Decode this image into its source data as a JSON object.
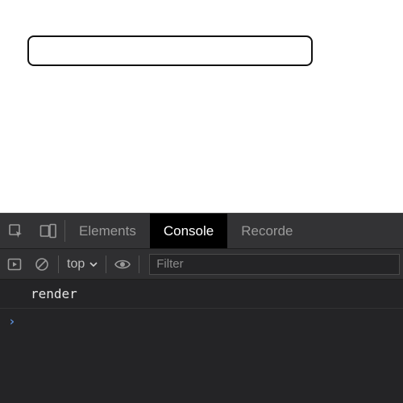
{
  "page": {
    "input_value": ""
  },
  "devtools": {
    "tabs": {
      "elements": "Elements",
      "console": "Console",
      "recorder": "Recorde"
    },
    "active_tab": "console",
    "toolbar": {
      "context_label": "top",
      "filter_placeholder": "Filter"
    },
    "console": {
      "log_0": "render",
      "prompt": "›"
    }
  }
}
